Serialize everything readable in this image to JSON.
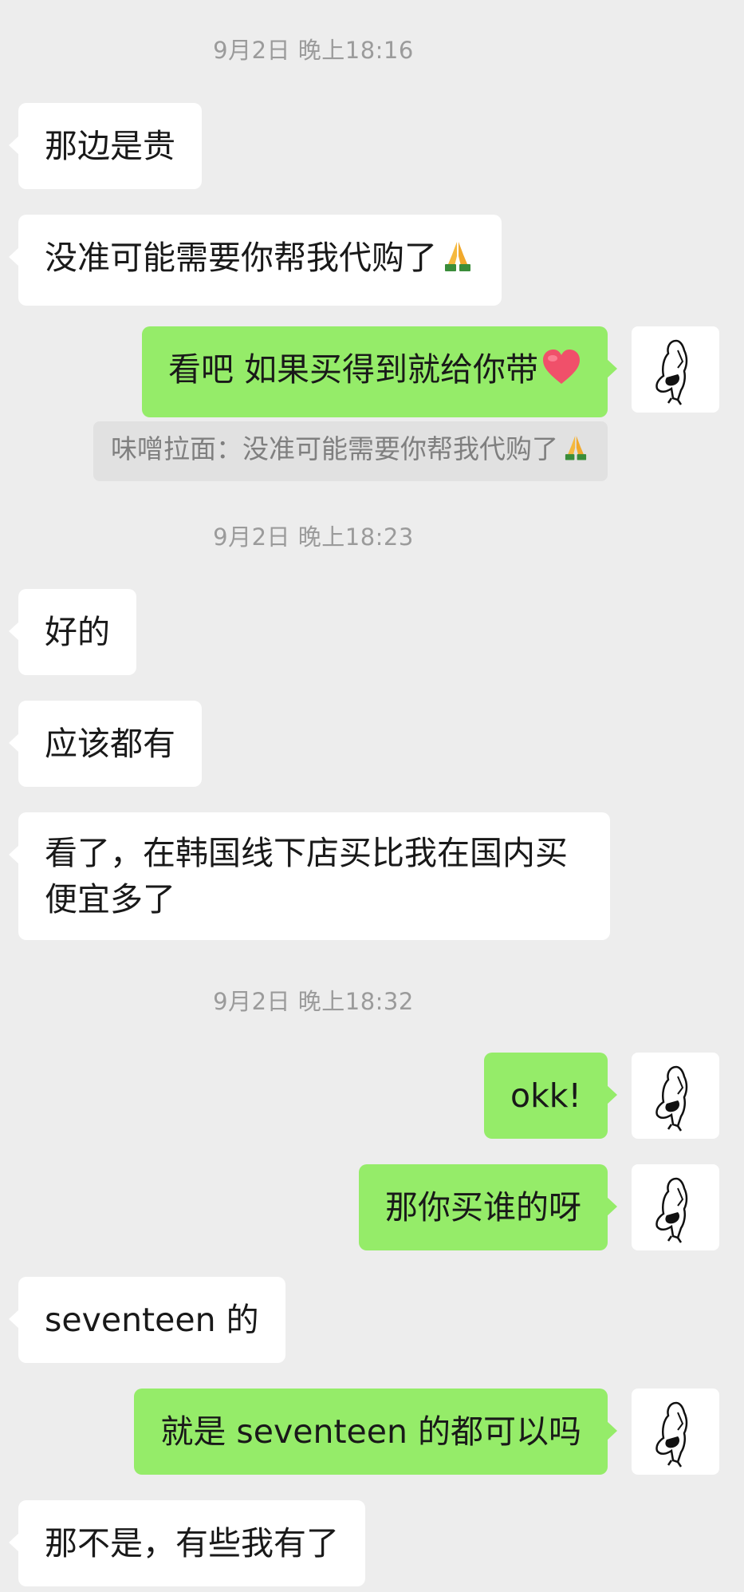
{
  "conversation": {
    "timestamps": [
      "9月2日 晚上18:16",
      "9月2日 晚上18:23",
      "9月2日 晚上18:32"
    ],
    "messages": [
      {
        "side": "left",
        "text": "那边是贵"
      },
      {
        "side": "left",
        "text": "没准可能需要你帮我代购了",
        "emoji": "🙏"
      },
      {
        "side": "right",
        "text": "看吧 如果买得到就给你带",
        "emoji": "❤️"
      },
      {
        "side": "quote",
        "text": "味噌拉面：没准可能需要你帮我代购了",
        "emoji": "🙏"
      },
      {
        "side": "left",
        "text": "好的"
      },
      {
        "side": "left",
        "text": "应该都有"
      },
      {
        "side": "left",
        "text": "看了，在韩国线下店买比我在国内买便宜多了"
      },
      {
        "side": "right",
        "text": "okk!"
      },
      {
        "side": "right",
        "text": "那你买谁的呀"
      },
      {
        "side": "left",
        "text": "seventeen 的"
      },
      {
        "side": "right",
        "text": "就是 seventeen 的都可以吗"
      },
      {
        "side": "left",
        "text": "那不是，有些我有了"
      }
    ]
  },
  "icons": {
    "avatar": "sketch-figure-avatar",
    "pray": "folded-hands-emoji",
    "heart": "red-heart-emoji"
  },
  "colors": {
    "background": "#ededed",
    "incoming_bubble": "#ffffff",
    "outgoing_bubble": "#95ec69",
    "quote_bg": "#e1e1e1",
    "timestamp": "#9b9b9b"
  }
}
